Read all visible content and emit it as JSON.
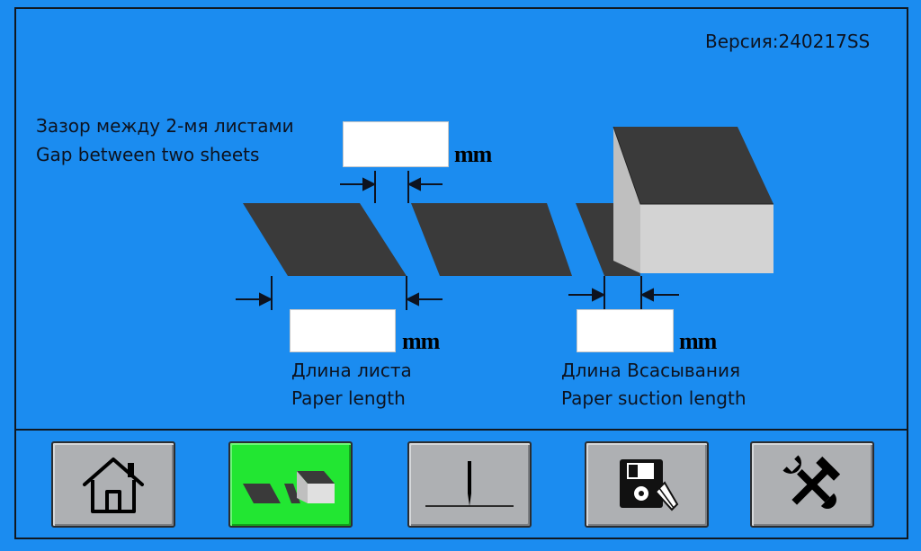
{
  "header": {
    "version": "Версия:240217SS"
  },
  "gap": {
    "label_ru": "Зазор между 2-мя листами",
    "label_en": "Gap between two sheets",
    "value": "",
    "unit": "mm"
  },
  "paper_length": {
    "label_ru": "Длина листа",
    "label_en": "Paper length",
    "value": "",
    "unit": "mm"
  },
  "suction_length": {
    "label_ru": "Длина Всасывания",
    "label_en": "Paper suction length",
    "value": "",
    "unit": "mm"
  },
  "toolbar": {
    "buttons": [
      {
        "icon": "home-icon",
        "active": false
      },
      {
        "icon": "sheets-feed-icon",
        "active": true
      },
      {
        "icon": "knife-cut-icon",
        "active": false
      },
      {
        "icon": "save-disk-icon",
        "active": false
      },
      {
        "icon": "tools-icon",
        "active": false
      }
    ]
  },
  "colors": {
    "background": "#1b8cf0",
    "active_button": "#22e632",
    "button": "#aeb0b3",
    "sheet": "#3a3a3a"
  }
}
